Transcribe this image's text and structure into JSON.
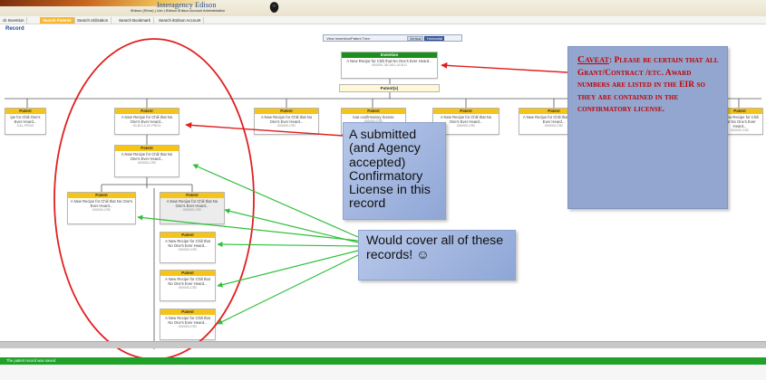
{
  "header": {
    "app_title": "Interagency Edison",
    "subtitle": "iEdison (Show) | Join | iEdison iEdison Account Administration",
    "nav_tabs": [
      {
        "label": "ck Invention",
        "active": false
      },
      {
        "label": "Search Patents",
        "active": true
      },
      {
        "label": "Search Utilization",
        "active": false
      },
      {
        "label": "Search Bookmark",
        "active": false
      },
      {
        "label": "Search iEdison Account",
        "active": false
      }
    ]
  },
  "page_title": "Record",
  "view_toggle": {
    "label": "View Invention/Patent Tree:",
    "option_off": "Vertical",
    "option_on": "Horizontal"
  },
  "tree": {
    "invention": {
      "type": "Invention",
      "title": "A New Recipe for Chili that No One's Ever Heard...",
      "id": "000000-78C4D1-00-B-D"
    },
    "band_label": "Patent(s)",
    "nodes": [
      {
        "key": "l1",
        "type": "Patent",
        "title": "ipe for Chili One's Ever Heard...",
        "id": "CAL-FRO/2"
      },
      {
        "key": "a1",
        "type": "Patent",
        "title": "A New Recipe for Chili that No One's Ever Heard...",
        "id": "00-B-D-0-02 PROV"
      },
      {
        "key": "m1",
        "type": "Patent",
        "title": "A New Recipe for Chili that No One's Ever Heard...",
        "id": "000000-CR2"
      },
      {
        "key": "m2",
        "type": "Patent",
        "title": "tout confirmatory license",
        "id": "000000-CR2"
      },
      {
        "key": "m3",
        "type": "Patent",
        "title": "A New Recipe for Chili that No One's Ever Heard...",
        "id": "000000-CR2"
      },
      {
        "key": "r1",
        "type": "Patent",
        "title": "A New Recipe for Chili that No One's Ever Heard...",
        "id": "000000-CR2"
      },
      {
        "key": "r2",
        "type": "Patent",
        "title": "A New Recipe for Chili that No One's Ever Heard...",
        "id": "000000-CR2"
      },
      {
        "key": "a2",
        "type": "Patent",
        "title": "A New Recipe for Chili that No One's Ever Heard...",
        "id": "000000-CR2"
      },
      {
        "key": "a3",
        "type": "Patent",
        "title": "A New Recipe for Chili that No One's Ever Heard...",
        "id": "000000-CR2"
      },
      {
        "key": "a4",
        "type": "Patent",
        "title": "A New Recipe for Chili that No One's Ever Heard...",
        "id": "000000-CR2"
      },
      {
        "key": "a5",
        "type": "Patent",
        "title": "A New Recipe for Chili that No One's Ever Heard...",
        "id": "000000-CR2"
      },
      {
        "key": "a6",
        "type": "Patent",
        "title": "A New Recipe for Chili that No One's Ever Heard...",
        "id": "000000-CR2"
      },
      {
        "key": "a7",
        "type": "Patent",
        "title": "A New Recipe for Chili that No One's Ever Heard...",
        "id": "000000-CR2"
      },
      {
        "key": "a8",
        "type": "Patent",
        "title": "A New Recipe for Chili that No One's Ever Heard...",
        "id": "000000-CR2"
      }
    ]
  },
  "callouts": {
    "submitted": "A submitted (and Agency accepted) Confirmatory License in this record",
    "cover": "Would cover all of these records! ☺",
    "caveat_title": "Caveat",
    "caveat_body": "Please be certain that all Grant/Contract /etc. Award numbers are listed in the EIR so they are contained in the confirmatory license."
  },
  "status": {
    "message": "The patent record was saved."
  },
  "colors": {
    "node_header": "#f6c416",
    "invention_header": "#1b8e1b",
    "annotation_red": "#e02020",
    "arrow_green": "#2fbf3a",
    "status_green": "#1fa12a",
    "callout_blue": "#93a6cf",
    "nav_active": "#f7b733"
  }
}
